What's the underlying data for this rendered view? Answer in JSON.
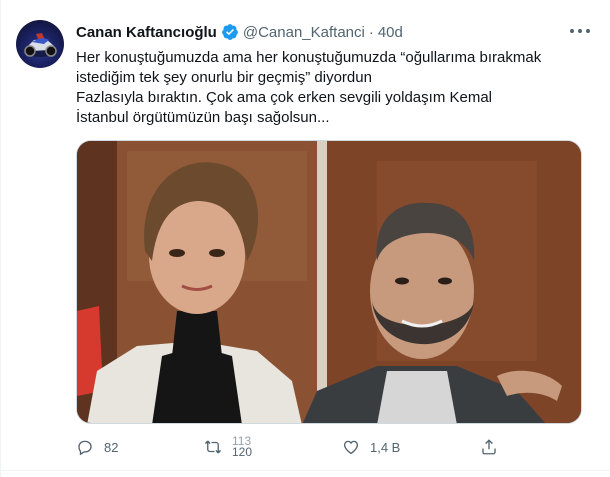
{
  "author": {
    "name": "Canan Kaftancıoğlu",
    "handle": "@Canan_Kaftanci",
    "separator": "·",
    "time": "40d",
    "verified": true,
    "avatar_icon": "avatar-image"
  },
  "tweet": {
    "lines": [
      "Her konuştuğumuzda ama her konuştuğumuzda “oğullarıma bırakmak",
      "istediğim tek şey onurlu bir geçmiş” diyordun",
      "Fazlasıyla bıraktın. Çok ama çok erken sevgili yoldaşım Kemal",
      "İstanbul örgütümüzün başı sağolsun..."
    ]
  },
  "actions": {
    "reply_count": "82",
    "retweet_count_line1": "113",
    "retweet_count_line2": "120",
    "like_count": "1,4 B",
    "icons": [
      "reply-icon",
      "retweet-icon",
      "like-icon",
      "share-icon"
    ]
  },
  "colors": {
    "text": "#0f1419",
    "secondary": "#536471",
    "verified": "#1d9bf0",
    "border": "#cfd9de"
  }
}
